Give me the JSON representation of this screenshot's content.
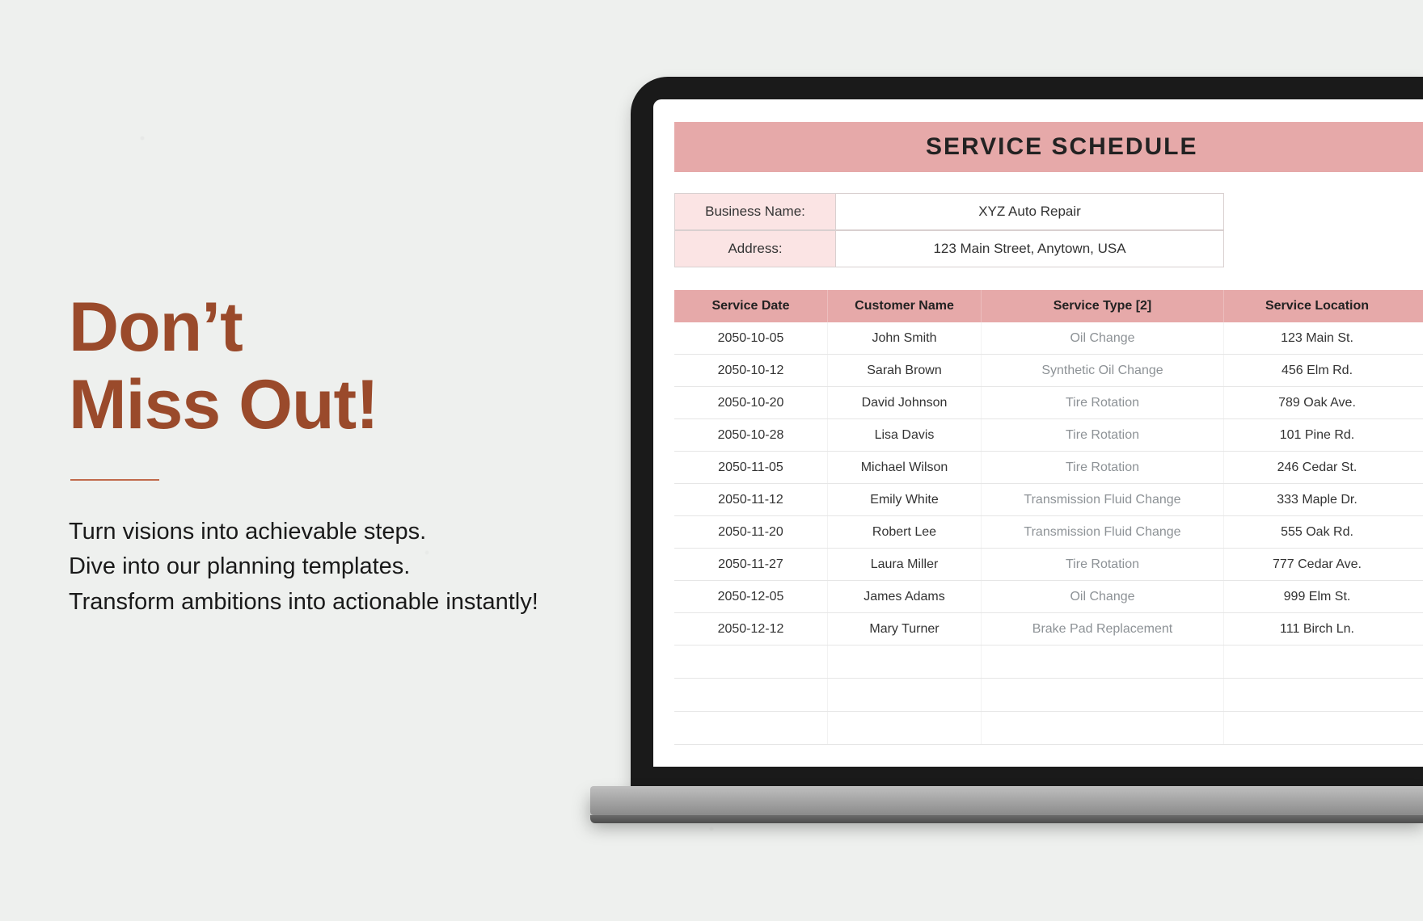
{
  "headline": {
    "line1": "Don’t",
    "line2": "Miss Out!"
  },
  "body": {
    "line1": "Turn visions into achievable steps.",
    "line2": "Dive into our planning templates.",
    "line3": "Transform ambitions into actionable instantly!"
  },
  "screen": {
    "title": "SERVICE SCHEDULE",
    "info": [
      {
        "label": "Business Name:",
        "value": "XYZ Auto Repair"
      },
      {
        "label": "Address:",
        "value": "123 Main Street, Anytown, USA"
      }
    ],
    "columns": [
      "Service Date",
      "Customer Name",
      "Service Type [2]",
      "Service Location"
    ],
    "rows": [
      {
        "date": "2050-10-05",
        "customer": "John Smith",
        "service": "Oil Change",
        "location": "123 Main St."
      },
      {
        "date": "2050-10-12",
        "customer": "Sarah Brown",
        "service": "Synthetic Oil Change",
        "location": "456 Elm Rd."
      },
      {
        "date": "2050-10-20",
        "customer": "David Johnson",
        "service": "Tire Rotation",
        "location": "789 Oak Ave."
      },
      {
        "date": "2050-10-28",
        "customer": "Lisa Davis",
        "service": "Tire Rotation",
        "location": "101 Pine Rd."
      },
      {
        "date": "2050-11-05",
        "customer": "Michael Wilson",
        "service": "Tire Rotation",
        "location": "246 Cedar St."
      },
      {
        "date": "2050-11-12",
        "customer": "Emily White",
        "service": "Transmission Fluid Change",
        "location": "333 Maple Dr."
      },
      {
        "date": "2050-11-20",
        "customer": "Robert Lee",
        "service": "Transmission Fluid Change",
        "location": "555 Oak Rd."
      },
      {
        "date": "2050-11-27",
        "customer": "Laura Miller",
        "service": "Tire Rotation",
        "location": "777 Cedar Ave."
      },
      {
        "date": "2050-12-05",
        "customer": "James Adams",
        "service": "Oil Change",
        "location": "999 Elm St."
      },
      {
        "date": "2050-12-12",
        "customer": "Mary Turner",
        "service": "Brake Pad Replacement",
        "location": "111 Birch Ln."
      }
    ],
    "empty_rows": 3
  }
}
